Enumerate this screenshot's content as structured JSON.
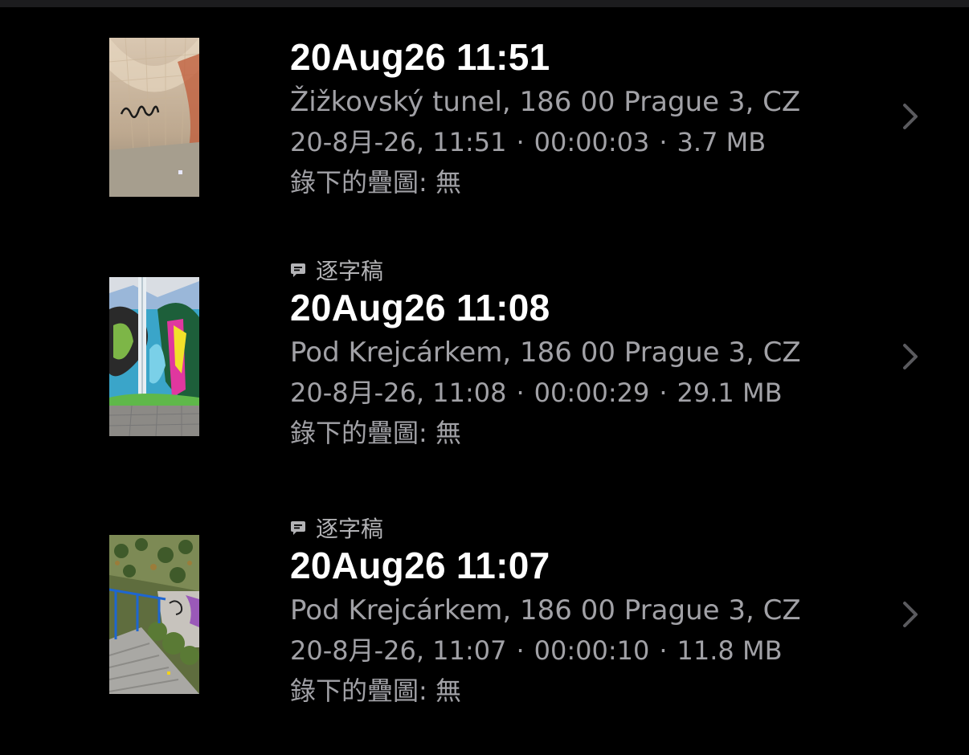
{
  "recordings": [
    {
      "transcript_label": "",
      "title": "20Aug26 11:51",
      "location": "Žižkovský tunel, 186 00 Prague 3, CZ",
      "date": "20-8月-26, 11:51",
      "duration": "00:00:03",
      "size": "3.7 MB",
      "overlay": "錄下的疊圖: 無",
      "thumbnail": "tunnel-graffiti-thumbnail"
    },
    {
      "transcript_label": "逐字稿",
      "title": "20Aug26 11:08",
      "location": "Pod Krejcárkem, 186 00 Prague 3, CZ",
      "date": "20-8月-26, 11:08",
      "duration": "00:00:29",
      "size": "29.1 MB",
      "overlay": "錄下的疊圖: 無",
      "thumbnail": "graffiti-wall-thumbnail"
    },
    {
      "transcript_label": "逐字稿",
      "title": "20Aug26 11:07",
      "location": "Pod Krejcárkem, 186 00 Prague 3, CZ",
      "date": "20-8月-26, 11:07",
      "duration": "00:00:10",
      "size": "11.8 MB",
      "overlay": "錄下的疊圖: 無",
      "thumbnail": "stairs-railing-thumbnail"
    }
  ],
  "separator": "·",
  "icons": {
    "transcript": "speech-bubble-icon",
    "disclosure": "chevron-right-icon"
  },
  "colors": {
    "background": "#000000",
    "title": "#ffffff",
    "secondary": "#a1a1a6",
    "chevron": "#5a5a5e"
  }
}
